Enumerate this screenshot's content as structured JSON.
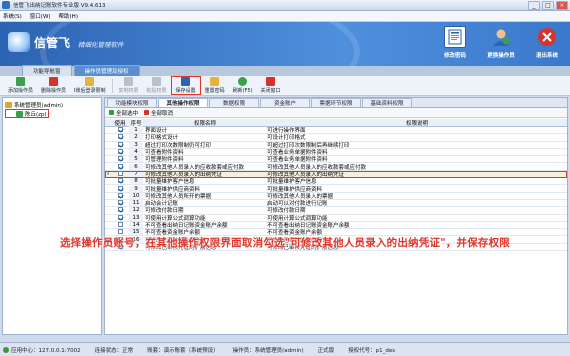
{
  "window": {
    "title": "信管飞出纳记账软件专业版 V9.4.613",
    "controls": [
      "_",
      "□",
      "×"
    ]
  },
  "menu": [
    "系统(S)",
    "窗口(W)",
    "帮助(H)"
  ],
  "banner": {
    "brand": "信管飞",
    "slogan": "精细化管理软件",
    "buttons": [
      "修改密码",
      "更换操作员",
      "退出系统"
    ]
  },
  "doc_tabs": [
    "功能导航窗",
    "操作员管理及授权"
  ],
  "toolbar": {
    "items": [
      {
        "label": "添加操作员",
        "enabled": true
      },
      {
        "label": "删除操作员",
        "enabled": true
      },
      {
        "label": "I账后登录限制",
        "enabled": true
      },
      {
        "label": "复制权限",
        "enabled": false
      },
      {
        "label": "粘贴权限",
        "enabled": false
      },
      {
        "label": "保存设置",
        "enabled": true,
        "highlighted": true
      },
      {
        "label": "重置密码",
        "enabled": true
      },
      {
        "label": "刷新(F5)",
        "enabled": true
      },
      {
        "label": "关闭窗口",
        "enabled": true
      }
    ]
  },
  "tree": {
    "root": "系统管理员(admin)",
    "child": "陈丘(zp)"
  },
  "sub_tabs": [
    "功能模块权限",
    "其他操作权限",
    "数据权限",
    "资金账户",
    "票据环节权限",
    "基础资料权限"
  ],
  "select_bar": {
    "all": "全部选中",
    "none": "全部取消"
  },
  "grid": {
    "headers": [
      "使用",
      "序号",
      "权限名称",
      "权限说明"
    ],
    "rows": [
      {
        "checked": true,
        "no": "1",
        "name": "界面设计",
        "desc": "可进行操作界面"
      },
      {
        "checked": true,
        "no": "2",
        "name": "打印格式设计",
        "desc": "可设计打印格式"
      },
      {
        "checked": true,
        "no": "3",
        "name": "超过打印次数限制仍可打印",
        "desc": "可超过打印次数限制后再继续打印"
      },
      {
        "checked": true,
        "no": "4",
        "name": "可查看附件资料",
        "desc": "可查看业务单据附件资料"
      },
      {
        "checked": true,
        "no": "5",
        "name": "可管理附件资料",
        "desc": "可查看业务单据附件资料"
      },
      {
        "checked": true,
        "no": "6",
        "name": "可修改其他人员录入的应收款套或应付款",
        "desc": "可修改其他人员录入的应收款套或应付款"
      },
      {
        "checked": false,
        "no": "7",
        "name": "可修改其他人员录入的出纳凭证",
        "desc": "可修改其他人员录入的出纳凭证",
        "highlight": true
      },
      {
        "checked": true,
        "no": "8",
        "name": "可批量维护客户信息",
        "desc": "可批量维护客户信息"
      },
      {
        "checked": true,
        "no": "9",
        "name": "可批量维护供应商资料",
        "desc": "可批量维护供应商资料"
      },
      {
        "checked": true,
        "no": "10",
        "name": "可修改其他人员所开的票据",
        "desc": "可修改其他人员录入的票据"
      },
      {
        "checked": true,
        "no": "11",
        "name": "启动会计记账",
        "desc": "启动可以对付款进行记账"
      },
      {
        "checked": true,
        "no": "12",
        "name": "可修改付款日期",
        "desc": "可修改付款日期"
      },
      {
        "checked": true,
        "no": "13",
        "name": "可使用计算公式调算功能",
        "desc": "可使用计算公式调算功能"
      },
      {
        "checked": false,
        "no": "14",
        "name": "不可查看出纳日记账资金账户余额",
        "desc": "不可查看出纳日记账资金账户余额"
      },
      {
        "checked": false,
        "no": "15",
        "name": "不可查看资金账户余额",
        "desc": "不可查看资金账户余额"
      },
      {
        "checked": true,
        "no": "16",
        "name": "可修改已审核的出纳凭证",
        "desc": "可修改已审核的出纳凭证"
      },
      {
        "checked": true,
        "no": "",
        "name": "可修改已审核凭证的扩展信息",
        "desc": "可修改已审核凭证的扩展信息"
      }
    ],
    "marker": "I"
  },
  "caption": "选择操作员账号，在其他操作权限界面取消勾选\"可修改其他人员录入的出纳凭证\"，并保存权限",
  "status": {
    "center": "应用中心：127.0.0.1:7002",
    "conn": "连接状态：正常",
    "account": "账套：演示账套（系统预设）",
    "operator": "操作员：系统管理员(admin)",
    "edition": "正式版",
    "license": "授权代号：p1_des"
  }
}
